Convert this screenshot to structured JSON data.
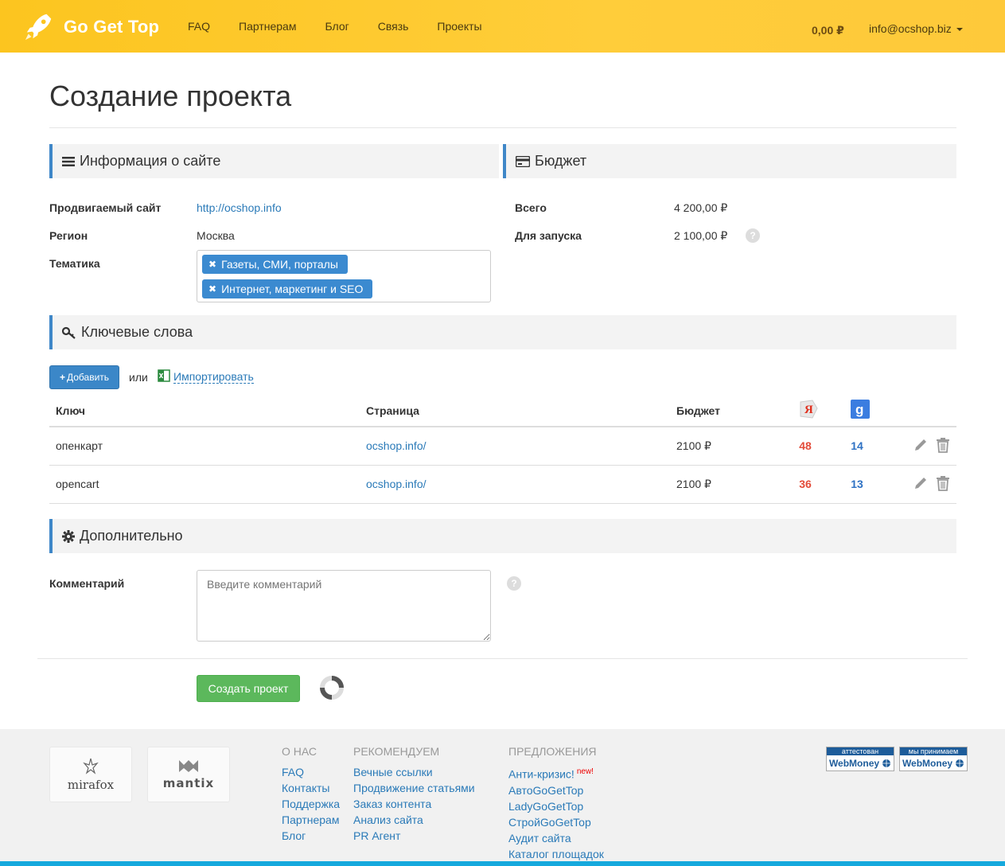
{
  "header": {
    "brand": "Go Get Top",
    "nav": [
      "FAQ",
      "Партнерам",
      "Блог",
      "Связь",
      "Проекты"
    ],
    "balance": "0,00 ₽",
    "user_email": "info@ocshop.biz"
  },
  "page_title": "Создание проекта",
  "site_info": {
    "heading": "Информация о сайте",
    "site_label": "Продвигаемый сайт",
    "site_value": "http://ocshop.info",
    "region_label": "Регион",
    "region_value": "Москва",
    "topic_label": "Тематика",
    "tags": [
      "Газеты, СМИ, порталы",
      "Интернет, маркетинг и SEO"
    ]
  },
  "budget": {
    "heading": "Бюджет",
    "total_label": "Всего",
    "total_value": "4 200,00 ₽",
    "launch_label": "Для запуска",
    "launch_value": "2 100,00 ₽"
  },
  "keywords": {
    "heading": "Ключевые слова",
    "add_button": "Добавить",
    "or_text": "или",
    "import_link": "Импортировать",
    "columns": {
      "key": "Ключ",
      "page": "Страница",
      "budget": "Бюджет"
    },
    "rows": [
      {
        "key": "опенкарт",
        "page": "ocshop.info/",
        "budget": "2100 ₽",
        "yandex": "48",
        "google": "14"
      },
      {
        "key": "opencart",
        "page": "ocshop.info/",
        "budget": "2100 ₽",
        "yandex": "36",
        "google": "13"
      }
    ]
  },
  "extra": {
    "heading": "Дополнительно",
    "comment_label": "Комментарий",
    "comment_placeholder": "Введите комментарий"
  },
  "submit_button": "Создать проект",
  "footer": {
    "partners": [
      "mirafox",
      "mantix"
    ],
    "about": {
      "title": "О НАС",
      "links": [
        "FAQ",
        "Контакты",
        "Поддержка",
        "Партнерам",
        "Блог"
      ]
    },
    "recommend": {
      "title": "РЕКОМЕНДУЕМ",
      "links": [
        "Вечные ссылки",
        "Продвижение статьями",
        "Заказ контента",
        "Анализ сайта",
        "PR Агент"
      ]
    },
    "offers": {
      "title": "ПРЕДЛОЖЕНИЯ",
      "links": [
        "Анти-кризис!",
        "АвтоGoGetTop",
        "LadyGoGetTop",
        "СтройGoGetTop",
        "Аудит сайта",
        "Каталог площадок"
      ],
      "new_badge": "new!"
    },
    "webmoney": [
      {
        "top": "аттестован",
        "bottom": "WebMoney"
      },
      {
        "top": "мы принимаем",
        "bottom": "WebMoney"
      }
    ]
  }
}
